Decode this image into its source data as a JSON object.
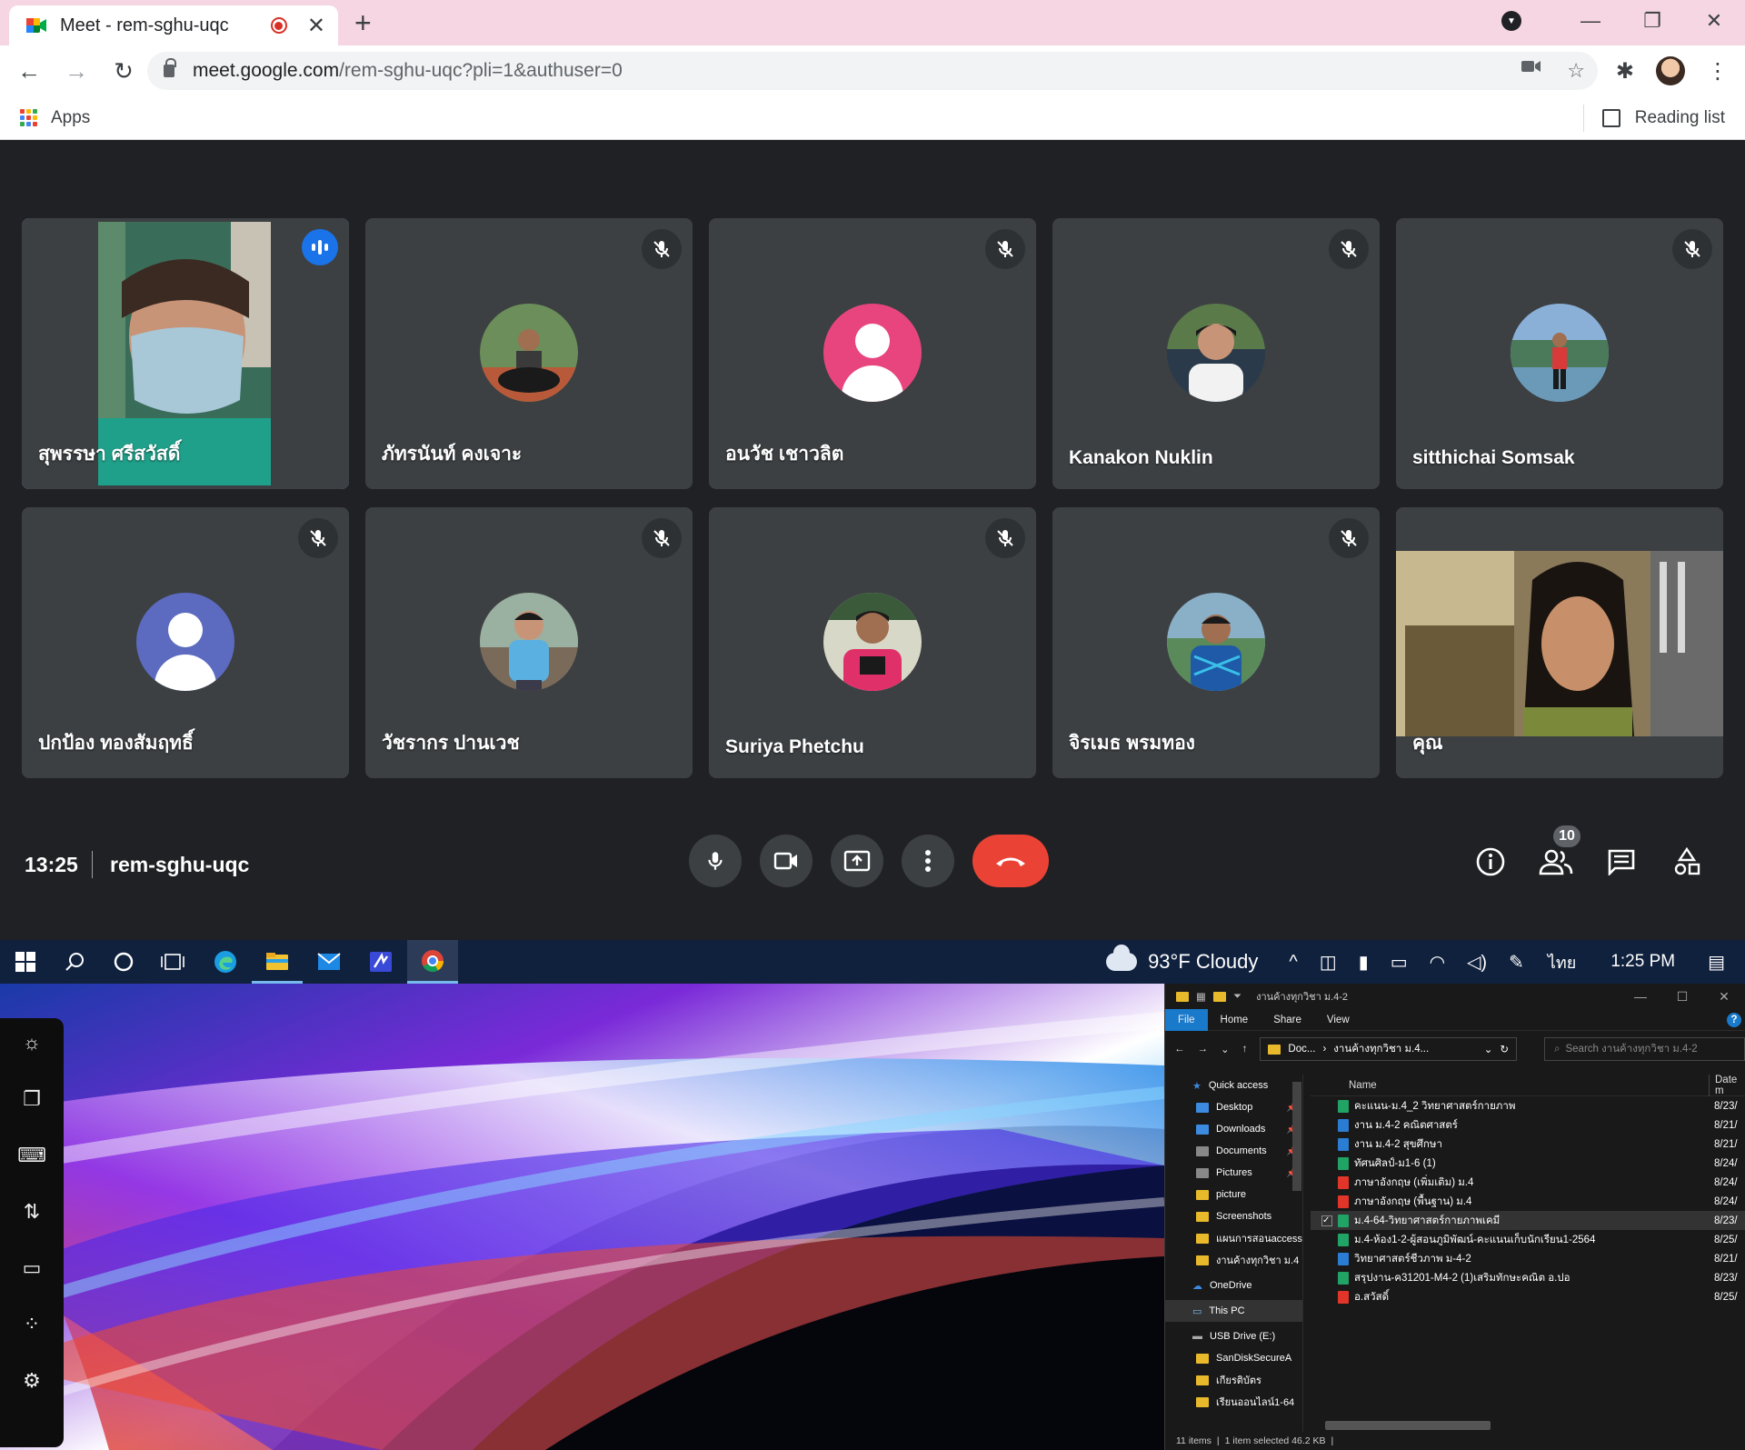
{
  "browser": {
    "tab_title": "Meet - rem-sghu-uqc",
    "new_tab": "+",
    "url_host": "meet.google.com",
    "url_path": "/rem-sghu-uqc?pli=1&authuser=0",
    "bookmarks": {
      "apps_label": "Apps",
      "reading_list_label": "Reading list"
    }
  },
  "meet": {
    "participants": [
      {
        "name": "สุพรรษา ศรีสวัสดิ์",
        "state": "speaking",
        "type": "video"
      },
      {
        "name": "ภัทรนันท์ คงเจาะ",
        "state": "muted",
        "type": "photo"
      },
      {
        "name": "อนวัช เชาวลิต",
        "state": "muted",
        "type": "default",
        "color": "#e8457e"
      },
      {
        "name": "Kanakon Nuklin",
        "state": "muted",
        "type": "photo"
      },
      {
        "name": "sitthichai Somsak",
        "state": "muted",
        "type": "photo"
      },
      {
        "name": "ปกป้อง ทองสัมฤทธิ์",
        "state": "muted",
        "type": "default",
        "color": "#5c6bc0"
      },
      {
        "name": "วัชรากร ปานเวช",
        "state": "muted",
        "type": "photo"
      },
      {
        "name": "Suriya Phetchu",
        "state": "muted",
        "type": "photo"
      },
      {
        "name": "จิรเมธ พรมทอง",
        "state": "muted",
        "type": "photo"
      },
      {
        "name": "คุณ",
        "state": "self",
        "type": "video"
      }
    ],
    "time": "13:25",
    "meeting_code": "rem-sghu-uqc",
    "participant_count": "10",
    "colors": {
      "end_call": "#ea4335",
      "speaking_outline": "#8ab4f8",
      "tile_bg": "#3c4043"
    }
  },
  "taskbar": {
    "weather": "93°F  Cloudy",
    "language": "ไทย",
    "time": "1:25 PM"
  },
  "explorer": {
    "title": "งานค้างทุกวิชา ม.4-2",
    "ribbon": [
      "File",
      "Home",
      "Share",
      "View"
    ],
    "path": [
      "Doc...",
      "งานค้างทุกวิชา ม.4..."
    ],
    "search_placeholder": "Search งานค้างทุกวิชา ม.4-2",
    "nav": [
      {
        "label": "Quick access",
        "kind": "star"
      },
      {
        "label": "Desktop",
        "kind": "blue",
        "pinned": true
      },
      {
        "label": "Downloads",
        "kind": "blue",
        "pinned": true
      },
      {
        "label": "Documents",
        "kind": "gray",
        "pinned": true
      },
      {
        "label": "Pictures",
        "kind": "gray",
        "pinned": true
      },
      {
        "label": "picture",
        "kind": "yellow"
      },
      {
        "label": "Screenshots",
        "kind": "yellow"
      },
      {
        "label": "แผนการสอนaccess",
        "kind": "yellow"
      },
      {
        "label": "งานค้างทุกวิชา ม.4",
        "kind": "yellow"
      },
      {
        "label": "OneDrive",
        "kind": "cloud"
      },
      {
        "label": "This PC",
        "kind": "pc",
        "selected": true
      },
      {
        "label": "USB Drive (E:)",
        "kind": "usb"
      },
      {
        "label": "SanDiskSecureA",
        "kind": "yellow"
      },
      {
        "label": "เกียรติบัตร",
        "kind": "yellow"
      },
      {
        "label": "เรียนออนไลน์1-64",
        "kind": "yellow"
      }
    ],
    "columns": {
      "name": "Name",
      "date": "Date m"
    },
    "files": [
      {
        "name": "คะแนน-ม.4_2 วิทยาศาสตร์กายภาพ",
        "date": "8/23/",
        "kind": "sheet"
      },
      {
        "name": "งาน ม.4-2 คณิตศาสตร์",
        "date": "8/21/",
        "kind": "doc"
      },
      {
        "name": "งาน ม.4-2 สุขศึกษา",
        "date": "8/21/",
        "kind": "doc"
      },
      {
        "name": "ทัศนศิลป์-ม1-6 (1)",
        "date": "8/24/",
        "kind": "sheet"
      },
      {
        "name": "ภาษาอังกฤษ (เพิ่มเติม) ม.4",
        "date": "8/24/",
        "kind": "pdf"
      },
      {
        "name": "ภาษาอังกฤษ (พื้นฐาน) ม.4",
        "date": "8/24/",
        "kind": "pdf"
      },
      {
        "name": "ม.4-64-วิทยาศาสตร์กายภาพเคมี",
        "date": "8/23/",
        "kind": "sheet",
        "selected": true
      },
      {
        "name": "ม.4-ห้อง1-2-ผู้สอนภูมิพัฒน์-คะแนนเก็บนักเรียน1-2564",
        "date": "8/25/",
        "kind": "sheet"
      },
      {
        "name": "วิทยาศาสตร์ชีวภาพ ม-4-2",
        "date": "8/21/",
        "kind": "doc"
      },
      {
        "name": "สรุปงาน-ค31201-M4-2 (1)เสริมทักษะคณิต อ.ปอ",
        "date": "8/23/",
        "kind": "sheet"
      },
      {
        "name": "อ.สวัสดิ์",
        "date": "8/25/",
        "kind": "pdf"
      }
    ],
    "status": {
      "items": "11 items",
      "selected": "1 item selected  46.2 KB"
    }
  }
}
